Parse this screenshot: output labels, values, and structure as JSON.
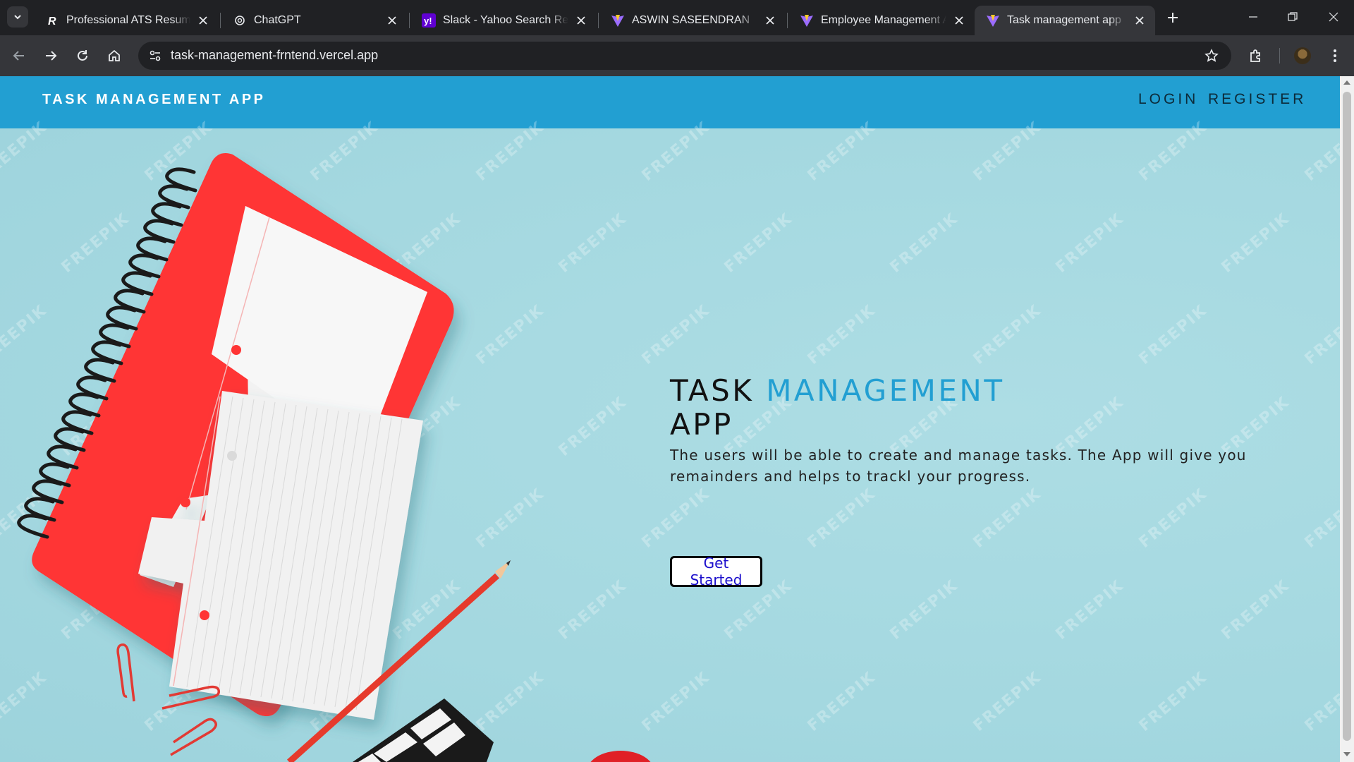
{
  "browser": {
    "tabs": [
      {
        "title": "Professional ATS Resume T",
        "favicon": "resume-r-icon",
        "active": false
      },
      {
        "title": "ChatGPT",
        "favicon": "openai-icon",
        "active": false
      },
      {
        "title": "Slack - Yahoo Search Resul",
        "favicon": "yahoo-icon",
        "active": false
      },
      {
        "title": "ASWIN SASEENDRAN",
        "favicon": "vite-icon",
        "active": false
      },
      {
        "title": "Employee Management Ap",
        "favicon": "vite-icon",
        "active": false
      },
      {
        "title": "Task management app",
        "favicon": "vite-icon",
        "active": true
      }
    ],
    "url": "task-management-frntend.vercel.app"
  },
  "navbar": {
    "brand": "TASK MANAGEMENT APP",
    "links": [
      "LOGIN",
      "REGISTER"
    ],
    "color": "#229fd2"
  },
  "hero": {
    "title_part1": "TASK",
    "title_accent": "MANAGEMENT",
    "title_part2": "APP",
    "description": "The users will be able to create and manage tasks. The App will give you remainders and helps to trackl your progress.",
    "cta_label": "Get Started",
    "watermark": "FREEPIK",
    "background_color": "#a8dbe3",
    "accent_color": "#229fd2"
  }
}
